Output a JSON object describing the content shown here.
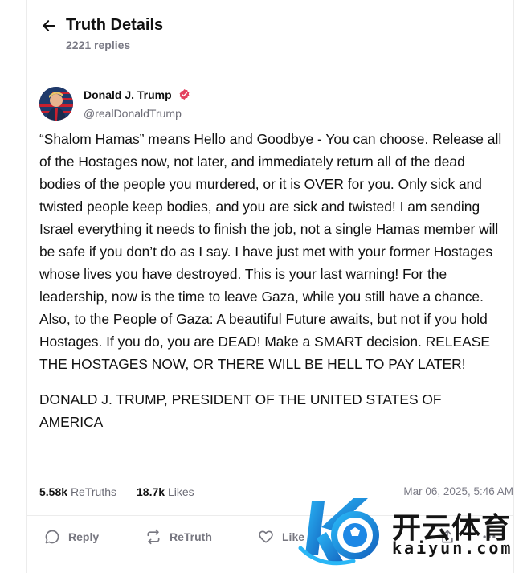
{
  "header": {
    "title": "Truth Details",
    "subtitle": "2221 replies"
  },
  "author": {
    "name": "Donald J. Trump",
    "handle": "@realDonaldTrump",
    "verified_color": "#e4405f"
  },
  "post": {
    "paragraphs": [
      "“Shalom Hamas” means Hello and Goodbye - You can choose. Release all of the Hostages now, not later, and immediately return all of the dead bodies of the people you murdered, or it is OVER for you. Only sick and twisted people keep bodies, and you are sick and twisted! I am sending Israel everything it needs to finish the job, not a single Hamas member will be safe if you don’t do as I say. I have just met with your former Hostages whose lives you have destroyed. This is your last warning! For the leadership, now is the time to leave Gaza, while you still have a chance. Also, to the People of Gaza: A beautiful Future awaits, but not if you hold Hostages. If you do, you are DEAD! Make a SMART decision. RELEASE THE HOSTAGES NOW, OR THERE WILL BE HELL TO PAY LATER!",
      "DONALD J. TRUMP, PRESIDENT OF THE UNITED STATES OF AMERICA"
    ]
  },
  "stats": {
    "retruths_count": "5.58k",
    "retruths_label": "ReTruths",
    "likes_count": "18.7k",
    "likes_label": "Likes",
    "timestamp": "Mar 06, 2025, 5:46 AM"
  },
  "actions": {
    "reply_label": "Reply",
    "retruth_label": "ReTruth",
    "like_label": "Like"
  },
  "watermark": {
    "cn_text": "开云体育",
    "en_text": "kaiyun.com"
  },
  "colors": {
    "text": "#111111",
    "muted": "#6b6b75",
    "divider": "#ececec",
    "watermark_blue": "#1e88e5"
  }
}
